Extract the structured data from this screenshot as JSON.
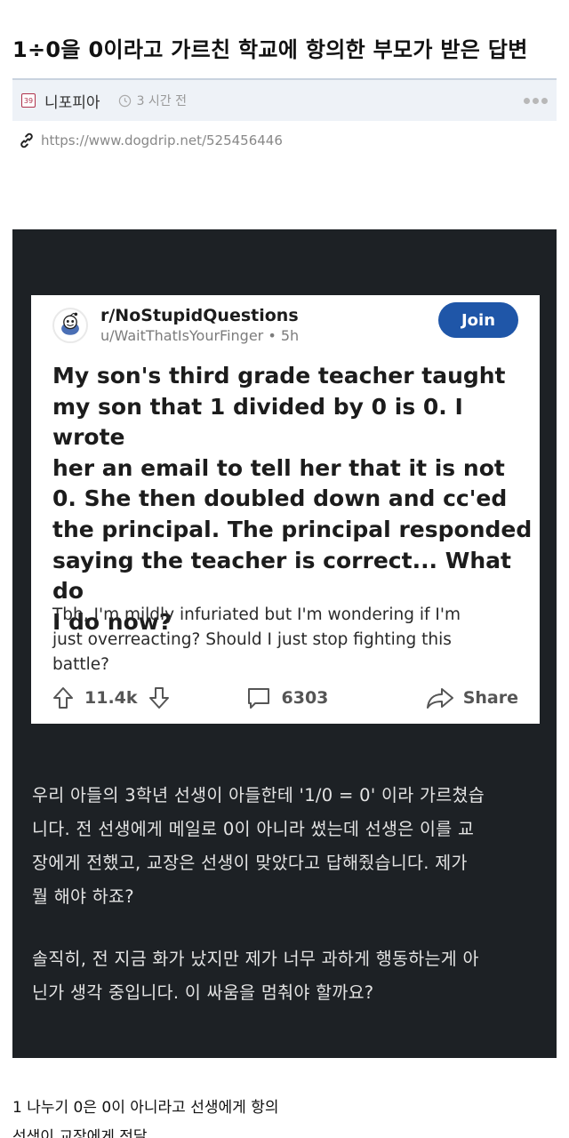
{
  "post": {
    "title": "1÷0을 0이라고 가르친 학교에 항의한 부모가 받은 답변",
    "board_name": "니포피아",
    "board_icon_text": "39",
    "time_ago": "3 시간 전",
    "source_url": "https://www.dogdrip.net/525456446"
  },
  "reddit": {
    "subreddit": "r/NoStupidQuestions",
    "user_time": "u/WaitThatIsYourFinger • 5h",
    "join_label": "Join",
    "title_lines": [
      "My son's third grade teacher taught",
      "my son that 1 divided by 0 is 0. I wrote",
      "her an email to tell her that it is not",
      "0. She then doubled down and cc'ed",
      "the principal. The principal responded",
      "saying the teacher is correct... What do",
      "I do now?"
    ],
    "body_lines": [
      "Tbh, I'm mildly infuriated but I'm wondering if I'm",
      "just overreacting? Should I just stop fighting this",
      "battle?"
    ],
    "upvotes": "11.4k",
    "comments": "6303",
    "share_label": "Share"
  },
  "translation": {
    "para1_lines": [
      "우리 아들의 3학년 선생이 아들한테 '1/0 = 0' 이라 가르쳤습",
      "니다. 전 선생에게 메일로 0이 아니라 썼는데 선생은 이를 교",
      "장에게 전했고, 교장은 선생이 맞았다고 답해줬습니다. 제가",
      "뭘 해야 하죠?"
    ],
    "para2_lines": [
      "솔직히, 전 지금 화가 났지만 제가 너무 과하게 행동하는게 아",
      "닌가 생각 중입니다. 이 싸움을 멈춰야 할까요?"
    ]
  },
  "footer": {
    "lines": [
      "1 나누기 0은 0이 아니라고 선생에게 항의",
      "선생이 교장에게 전달"
    ]
  },
  "colors": {
    "dark_bg": "#1d2125",
    "join_blue": "#1f56a8",
    "meta_bg": "#eef2f7"
  },
  "icons": [
    "clock-icon",
    "link-icon",
    "more-icon",
    "snoo-avatar-icon",
    "upvote-icon",
    "downvote-icon",
    "comment-icon",
    "share-icon"
  ]
}
